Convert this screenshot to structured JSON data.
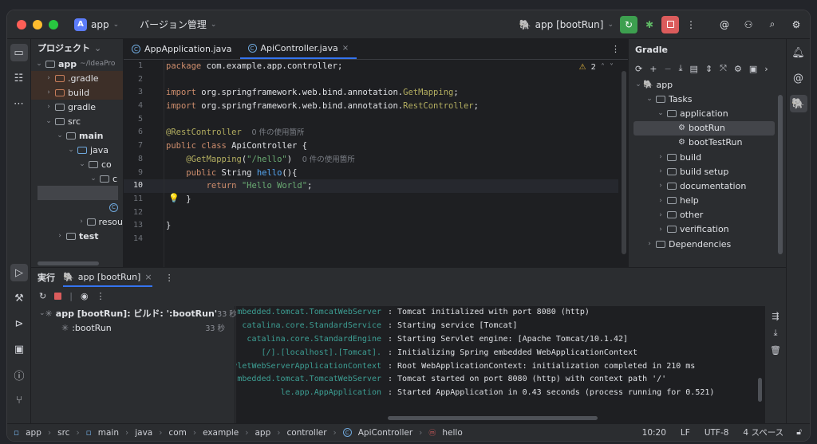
{
  "titlebar": {
    "project_letter": "A",
    "project_name": "app",
    "vcs_label": "バージョン管理",
    "run_config": "app [bootRun]"
  },
  "project_panel": {
    "title": "プロジェクト",
    "items": [
      {
        "label": "app",
        "extra": "~/IdeaPro",
        "bold": true
      },
      {
        "label": ".gradle"
      },
      {
        "label": "build"
      },
      {
        "label": "gradle"
      },
      {
        "label": "src"
      },
      {
        "label": "main",
        "bold": true
      },
      {
        "label": "java"
      },
      {
        "label": "co"
      },
      {
        "label": "c"
      },
      {
        "label": ""
      },
      {
        "label": ""
      },
      {
        "label": "resou"
      },
      {
        "label": "test",
        "bold": true
      }
    ]
  },
  "editor": {
    "tabs": [
      {
        "label": "AppApplication.java"
      },
      {
        "label": "ApiController.java"
      }
    ],
    "warning_count": "2",
    "lines": [
      "1",
      "2",
      "3",
      "4",
      "5",
      "6",
      "7",
      "8",
      "9",
      "10",
      "11",
      "12",
      "13",
      "14"
    ],
    "code": {
      "l1_kw": "package",
      "l1_rest": " com.example.app.controller;",
      "l3_kw": "import",
      "l3_pkg": " org.springframework.web.bind.annotation.",
      "l3_cls": "GetMapping",
      "l3_end": ";",
      "l4_kw": "import",
      "l4_pkg": " org.springframework.web.bind.annotation.",
      "l4_cls": "RestController",
      "l4_end": ";",
      "l6_ann": "@RestController",
      "l6_hint": "0 件の使用箇所",
      "l7_kw": "public class",
      "l7_rest": " ApiController {",
      "l8_ann": "@GetMapping",
      "l8_p": "(",
      "l8_str": "\"/hello\"",
      "l8_end": ")",
      "l8_hint": "0 件の使用箇所",
      "l9_kw": "public",
      "l9_type": " String ",
      "l9_fn": "hello",
      "l9_end": "(){",
      "l10_kw": "return",
      "l10_str": " \"Hello World\"",
      "l10_end": ";",
      "l11": "}",
      "l13": "}"
    }
  },
  "gradle": {
    "title": "Gradle",
    "items": [
      {
        "label": "app"
      },
      {
        "label": "Tasks"
      },
      {
        "label": "application"
      },
      {
        "label": "bootRun"
      },
      {
        "label": "bootTestRun"
      },
      {
        "label": "build"
      },
      {
        "label": "build setup"
      },
      {
        "label": "documentation"
      },
      {
        "label": "help"
      },
      {
        "label": "other"
      },
      {
        "label": "verification"
      },
      {
        "label": "Dependencies"
      }
    ]
  },
  "run": {
    "title": "実行",
    "tab": "app [bootRun]",
    "tree": [
      {
        "label": "app [bootRun]: ビルド: ':bootRun'",
        "time": "33 秒"
      },
      {
        "label": ":bootRun",
        "time": "33 秒"
      }
    ],
    "console": [
      {
        "src": "mbedded.tomcat.TomcatWebServer",
        "msg": ": Tomcat initialized with port 8080 (http)"
      },
      {
        "src": "catalina.core.StandardService",
        "msg": ": Starting service [Tomcat]"
      },
      {
        "src": "catalina.core.StandardEngine",
        "msg": ": Starting Servlet engine: [Apache Tomcat/10.1.42]"
      },
      {
        "src": ".[Tomcat].[localhost].[/]",
        "msg": ": Initializing Spring embedded WebApplicationContext"
      },
      {
        "src": "vletWebServerApplicationContext",
        "msg": ": Root WebApplicationContext: initialization completed in 210 ms"
      },
      {
        "src": "mbedded.tomcat.TomcatWebServer",
        "msg": ": Tomcat started on port 8080 (http) with context path '/'"
      },
      {
        "src": "le.app.AppApplication",
        "msg": ": Started AppApplication in 0.43 seconds (process running for 0.521)"
      }
    ]
  },
  "status": {
    "crumbs": [
      "app",
      "src",
      "main",
      "java",
      "com",
      "example",
      "app",
      "controller",
      "ApiController",
      "hello"
    ],
    "position": "10:20",
    "line_sep": "LF",
    "encoding": "UTF-8",
    "indent": "4 スペース"
  },
  "colors": {
    "accent": "#3574f0",
    "run_green": "#3d9f4f",
    "stop_red": "#db5c5c"
  }
}
